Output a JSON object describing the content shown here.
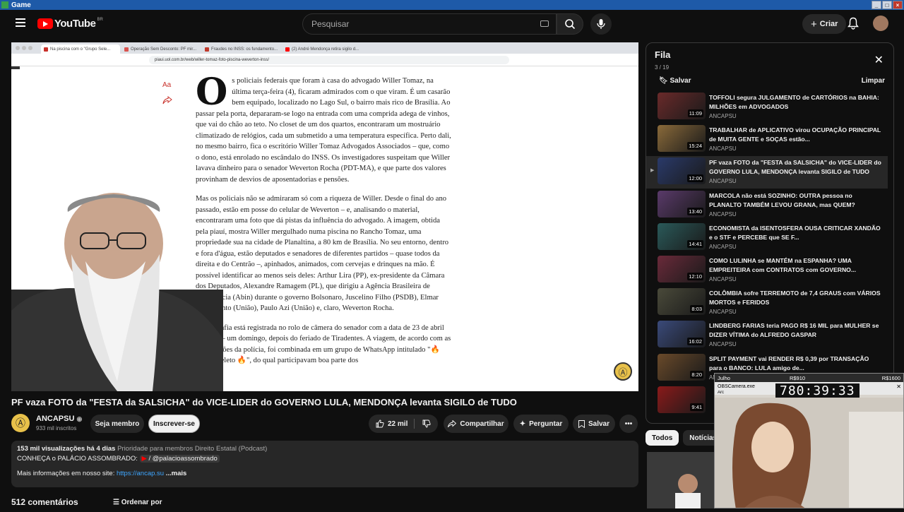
{
  "window": {
    "title": "Game"
  },
  "topbar": {
    "logo_text": "YouTube",
    "region": "BR",
    "search_placeholder": "Pesquisar",
    "create_label": "Criar"
  },
  "browser": {
    "tabs": [
      {
        "label": "Na piscina com o \"Grupo Sele...",
        "color": "#c8302a"
      },
      {
        "label": "Operação Sem Desconto: PF mir...",
        "color": "#d9534f"
      },
      {
        "label": "Fraudes no INSS: os fundamento...",
        "color": "#c0392b"
      },
      {
        "label": "(2) André Mendonça retira sigilo d...",
        "color": "#ff0000"
      }
    ],
    "url": "piaui.uol.com.br/web/willer-tomaz-foto-piscina-weverton-inss/"
  },
  "article": {
    "aa_label": "Aa",
    "dropcap": "O",
    "p1": "s policiais federais que foram à casa do advogado Willer Tomaz, na última terça-feira (4), ficaram admirados com o que viram. É um casarão bem equipado, localizado no Lago Sul, o bairro mais rico de Brasília. Ao passar pela porta, depararam-se logo na entrada com uma comprida adega de vinhos, que vai do chão ao teto. No closet de um dos quartos, encontraram um mostruário climatizado de relógios, cada um submetido a uma temperatura específica. Perto dali, no mesmo bairro, fica o escritório Willer Tomaz Advogados Associados – que, como o dono, está enrolado no escândalo do INSS. Os investigadores suspeitam que Willer lavava dinheiro para o senador Weverton Rocha (PDT-MA), e que parte dos valores provinham de desvios de aposentadorias e pensões.",
    "p2": "Mas os policiais não se admiraram só com a riqueza de Willer. Desde o final do ano passado, estão em posse do celular de Weverton – e, analisando o material, encontraram uma foto que dá pistas da influência do advogado. A imagem, obtida pela piauí, mostra Willer mergulhado numa piscina no Rancho Tomaz, uma propriedade sua na cidade de Planaltina, a 80 km de Brasília. No seu entorno, dentro e fora d'água, estão deputados e senadores de diferentes partidos – quase todos da direita e do Centrão –, apinhados, animados, com cervejas e drinques na mão. É possível identificar ao menos seis deles: Arthur Lira (PP), ex-presidente da Câmara dos Deputados, Alexandre Ramagem (PL), que dirigiu a Agência Brasileira de Inteligência (Abin) durante o governo Bolsonaro, Juscelino Filho (PSDB), Elmar Nascimento (União), Paulo Azi (União) e, claro, Weverton Rocha.",
    "p3": "A fotografia está registrada no rolo de câmera do senador com a data de 23 de abril de 2023 – um domingo, depois do feriado de Tiradentes. A viagem, de acordo com as informações da polícia, foi combinada em um grupo de WhatsApp intitulado \"🔥 Grupo Seleto 🔥\", do qual participavam boa parte dos"
  },
  "video": {
    "title": "PF vaza FOTO da \"FESTA da SALSICHA\" do VICE-LIDER do GOVERNO LULA, MENDONÇA levanta SIGILO de TUDO",
    "channel": "ANCAPSU",
    "subscribers": "933 mil inscritos",
    "join_label": "Seja membro",
    "subscribe_label": "Inscrever-se",
    "likes": "22 mil",
    "share_label": "Compartilhar",
    "ask_label": "Perguntar",
    "save_label": "Salvar",
    "desc_stats": "153 mil visualizações  há 4 dias",
    "desc_tags": "Prioridade para membros  Direito Estatal (Podcast)",
    "desc_line2": "CONHEÇA o PALÁCIO ASSOMBRADO:",
    "desc_handle": "/ @palacioassombrado",
    "desc_line3": "Mais informações em nosso site:",
    "desc_link": "https://ancap.su",
    "desc_more": "...mais",
    "comments": "512 comentários",
    "order_label": "Ordenar por"
  },
  "queue": {
    "title": "Fila",
    "count": "3 / 19",
    "save_label": "Salvar",
    "clear_label": "Limpar",
    "items": [
      {
        "title": "TOFFOLI segura JULGAMENTO de CARTÓRIOS na BAHIA: MILHÕES em ADVOGADOS",
        "channel": "ANCAPSU",
        "duration": "11:09",
        "thumb": "#6a2a2a"
      },
      {
        "title": "TRABALHAR de APLICATIVO virou OCUPAÇÃO PRINCIPAL de MUITA GENTE e SOÇAS estão...",
        "channel": "ANCAPSU",
        "duration": "15:24",
        "thumb": "#8a6a3a"
      },
      {
        "title": "PF vaza FOTO da \"FESTA da SALSICHA\" do VICE-LIDER do GOVERNO LULA, MENDONÇA levanta SIGILO de TUDO",
        "channel": "ANCAPSU",
        "duration": "12:00",
        "thumb": "#2a3a6a",
        "active": true
      },
      {
        "title": "MARCOLA não está SOZINHO: OUTRA pessoa no PLANALTO TAMBÉM LEVOU GRANA, mas QUEM?",
        "channel": "ANCAPSU",
        "duration": "13:40",
        "thumb": "#5a3a6a"
      },
      {
        "title": "ECONOMISTA da ISENTOSFERA OUSA CRITICAR XANDÃO e o STF e PERCEBE que SE F...",
        "channel": "ANCAPSU",
        "duration": "14:41",
        "thumb": "#2a5a5a"
      },
      {
        "title": "COMO LULINHA se MANTÉM na ESPANHA? UMA EMPREITEIRA com CONTRATOS com GOVERNO...",
        "channel": "ANCAPSU",
        "duration": "12:10",
        "thumb": "#6a2a3a"
      },
      {
        "title": "COLÔMBIA sofre TERREMOTO de 7,4 GRAUS com VÁRIOS MORTOS e FERIDOS",
        "channel": "ANCAPSU",
        "duration": "8:03",
        "thumb": "#4a4a3a"
      },
      {
        "title": "LINDBERG FARIAS teria PAGO R$ 16 MIL para MULHER se DIZER VÍTIMA do ALFREDO GASPAR",
        "channel": "ANCAPSU",
        "duration": "16:02",
        "thumb": "#3a4a7a"
      },
      {
        "title": "SPLIT PAYMENT vai RENDER R$ 0,39 por TRANSAÇÃO para o BANCO: LULA amigo de...",
        "channel": "ANCAPSU",
        "duration": "8:20",
        "thumb": "#6a4a2a"
      },
      {
        "title": "",
        "channel": "",
        "duration": "9:41",
        "thumb": "#8a1a1a"
      }
    ]
  },
  "chips": [
    "Todos",
    "Notícias m"
  ],
  "camera": {
    "name": "Julho",
    "value1": "R$910",
    "value2": "R$1600",
    "app": "OBSCamera.exe",
    "file": "Arc",
    "timer": "780:39:33"
  }
}
